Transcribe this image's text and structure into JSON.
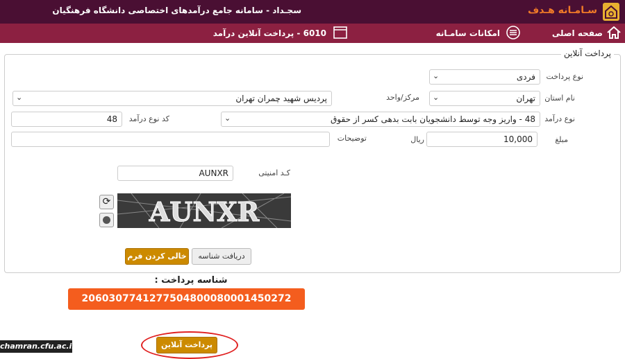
{
  "header": {
    "logo_text": "سـامـانه هـدف",
    "app_title": "سجـداد - سامانه جامع درآمدهای اختصاصی دانشگاه فرهنگیان"
  },
  "nav": {
    "home": "صفحه اصلی",
    "features": "امکانات سامـانه",
    "page": "6010 - پرداخت آنلاین درآمد"
  },
  "form": {
    "legend": "پرداخت آنلاین",
    "payment_type_label": "نوع پرداخت",
    "payment_type_value": "فردی",
    "province_label": "نام استان",
    "province_value": "تهران",
    "center_label": "مرکز/واحد",
    "center_value": "پردیس شهید چمران تهران",
    "income_type_label": "نوع درآمد",
    "income_type_value": "48 - واریز وجه توسط دانشجویان بابت بدهی کسر از حقوق",
    "income_code_label": "کد نوع درآمد",
    "income_code_value": "48",
    "amount_label": "مبلغ",
    "amount_value": "10,000",
    "amount_unit": "ریال",
    "description_label": "توضیحات",
    "description_value": "",
    "security_label": "کـد امنیتی",
    "security_value": "AUNXR",
    "captcha_text": "AUNXR",
    "get_id_button": "دریافت شناسه",
    "clear_button": "خالی کردن فرم"
  },
  "payment": {
    "id_label": "شناسه پرداخت :",
    "id_value": "2060307741277504800080001450272",
    "online_button": "پرداخت آنلاین"
  },
  "watermark": "chamran.cfu.ac.ir",
  "icons": {
    "logo": "house-logo-icon",
    "home": "home-icon",
    "menu": "menu-icon",
    "window": "window-icon",
    "refresh": "refresh-icon",
    "audio": "audio-icon"
  },
  "colors": {
    "titlebar": "#4a0f33",
    "navbar": "#8c2041",
    "accent": "#f45d1e",
    "button": "#cc8a00"
  }
}
